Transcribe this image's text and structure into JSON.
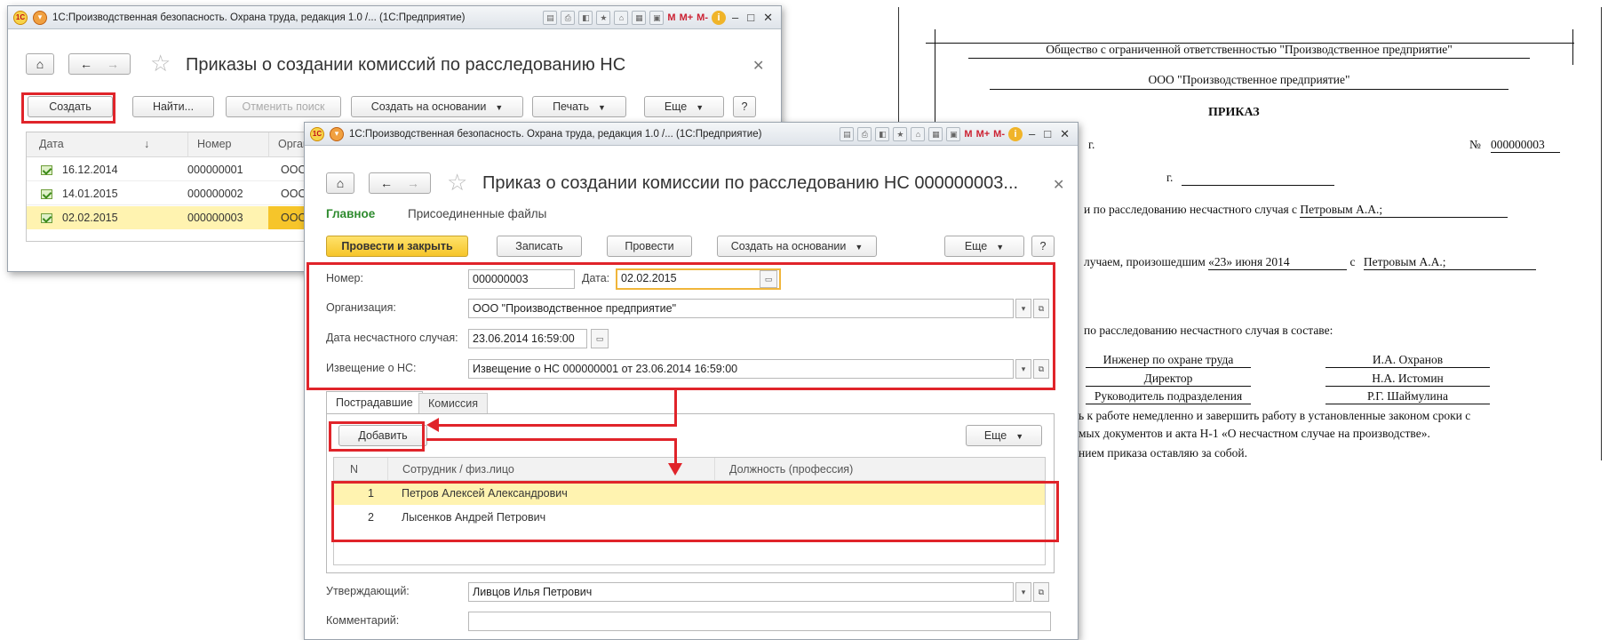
{
  "list_window": {
    "title": "1С:Производственная безопасность. Охрана труда, редакция 1.0 /...  (1С:Предприятие)",
    "form_title": "Приказы о создании комиссий по расследованию НС",
    "toolbar": {
      "create": "Создать",
      "find": "Найти...",
      "cancel_search": "Отменить поиск",
      "create_based_on": "Создать на основании",
      "print": "Печать",
      "more": "Еще",
      "help": "?"
    },
    "columns": [
      "Дата",
      "Номер",
      "Орган"
    ],
    "rows": [
      {
        "date": "16.12.2014",
        "number": "000000001",
        "org": "ООО"
      },
      {
        "date": "14.01.2015",
        "number": "000000002",
        "org": "ООО"
      },
      {
        "date": "02.02.2015",
        "number": "000000003",
        "org": "ООО"
      }
    ]
  },
  "doc_window": {
    "title": "1С:Производственная безопасность. Охрана труда, редакция 1.0 /...  (1С:Предприятие)",
    "form_title": "Приказ о создании комиссии по расследованию НС 000000003...",
    "nav_tabs": {
      "main": "Главное",
      "files": "Присоединенные файлы"
    },
    "toolbar": {
      "post_close": "Провести и закрыть",
      "save": "Записать",
      "post": "Провести",
      "create_based_on": "Создать на основании",
      "more": "Еще",
      "help": "?"
    },
    "fields": {
      "number_label": "Номер:",
      "number": "000000003",
      "date_label": "Дата:",
      "date": "02.02.2015",
      "org_label": "Организация:",
      "org": "ООО \"Производственное предприятие\"",
      "accident_date_label": "Дата несчастного случая:",
      "accident_date": "23.06.2014 16:59:00",
      "notice_label": "Извещение о НС:",
      "notice": "Извещение о НС 000000001 от 23.06.2014 16:59:00"
    },
    "tabs": {
      "victims": "Пострадавшие",
      "commission": "Комиссия"
    },
    "table_toolbar": {
      "add": "Добавить",
      "more": "Еще"
    },
    "table_columns": [
      "N",
      "Сотрудник / физ.лицо",
      "Должность (профессия)"
    ],
    "table_rows": [
      {
        "n": "1",
        "person": "Петров Алексей Александрович",
        "position": ""
      },
      {
        "n": "2",
        "person": "Лысенков Андрей Петрович",
        "position": ""
      }
    ],
    "approver_label": "Утверждающий:",
    "approver": "Ливцов Илья Петрович",
    "comment_label": "Комментарий:",
    "comment": ""
  },
  "document": {
    "company_full": "Общество с ограниченной ответственностью \"Производственное предприятие\"",
    "company_short": "ООО \"Производственное предприятие\"",
    "heading": "ПРИКАЗ",
    "year_suffix": "г.",
    "number_label": "№",
    "number": "000000003",
    "city_suffix": "г.",
    "line1_prefix": "и по расследованию несчастного случая с",
    "line1_name": "Петровым А.А.;",
    "line2_prefix": "лучаем, произошедшим",
    "line2_date": "«23» июня 2014",
    "line2_with": "с",
    "line2_name": "Петровым А.А.;",
    "line3": "по расследованию несчастного случая в составе:",
    "members": [
      {
        "role": "Инженер по охране труда",
        "name": "И.А. Охранов"
      },
      {
        "role": "Директор",
        "name": "Н.А. Истомин"
      },
      {
        "role": "Руководитель подразделения",
        "name": "Р.Г. Шаймулина"
      }
    ],
    "line4": "ь к работе немедленно и завершить работу в установленные законом сроки с",
    "line5": "мых документов и акта Н-1 «О несчастном случае на производстве».",
    "line6": "нием приказа оставляю за собой."
  },
  "colors": {
    "highlight": "#e0242a",
    "primary_button": "#f6c52a",
    "selected_row": "#fff3b0",
    "green_tab": "#2e8b2e"
  }
}
